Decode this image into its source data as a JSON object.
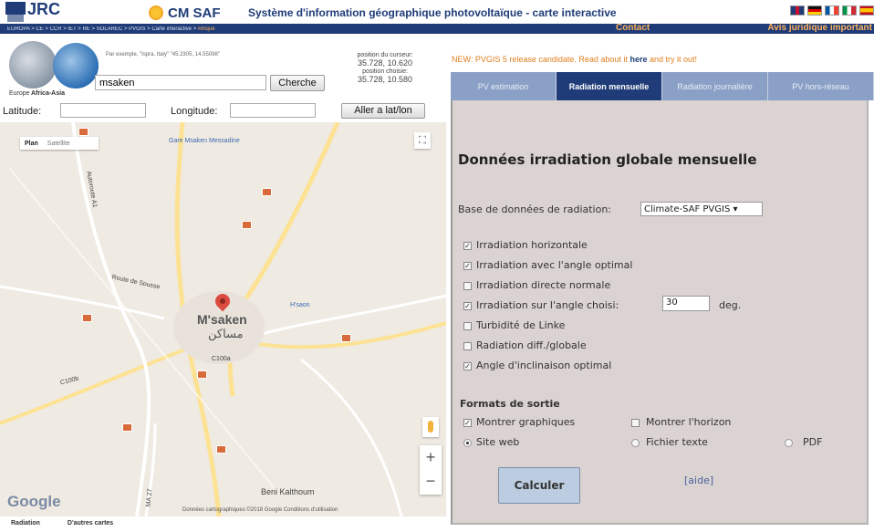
{
  "header": {
    "logo_text": "JRC",
    "cmsaf_text": "CM SAF",
    "title": "Système d'information géographique photovoltaïque - carte interactive",
    "breadcrumb": "EUROPA > CE > CCR > IET > RE > SOLAREC > PVGIS > Carte interactive > ",
    "breadcrumb_current": "Afrique",
    "contact": "Contact",
    "legal": "Avis juridique important",
    "flags": [
      {
        "name": "uk-flag",
        "colors": [
          "#1f3c78",
          "#ffffff",
          "#c8102e"
        ]
      },
      {
        "name": "de-flag",
        "colors": [
          "#111111",
          "#dd0000",
          "#ffce00"
        ]
      },
      {
        "name": "fr-flag",
        "colors": [
          "#0055a4",
          "#ffffff",
          "#ef4135"
        ]
      },
      {
        "name": "it-flag",
        "colors": [
          "#009246",
          "#ffffff",
          "#ce2b37"
        ]
      },
      {
        "name": "es-flag",
        "colors": [
          "#c60b1e",
          "#ffc400",
          "#c60b1e"
        ]
      }
    ]
  },
  "search": {
    "europe_label": "Europe",
    "africa_label": "Africa-Asia",
    "hint": "Par exemple, \"Ispra, Italy\" \"45.2305, 14.55098\"",
    "query": "msaken",
    "search_button": "Cherche",
    "cursor_label": "position du curseur:",
    "cursor_value": "35.728, 10.620",
    "chosen_label": "position choisie:",
    "chosen_value": "35.728, 10.580",
    "latitude_label": "Latitude:",
    "latitude_value": "",
    "longitude_label": "Longitude:",
    "longitude_value": "",
    "goto_button": "Aller a lat/lon"
  },
  "map": {
    "type_plan": "Plan",
    "type_satellite": "Satellite",
    "city": "M'saken",
    "city_ar": "مساكن",
    "poi_station": "Gare Msaken Messadine",
    "poi_right": "H'saon",
    "road_left": "Route de Sousse",
    "road_c100a": "C100a",
    "road_c100b": "C100b",
    "road_a1": "Autoroute A1",
    "road_ma": "MA 27",
    "village": "Beni Kalthoum",
    "credit": "Données cartographiques ©2018 Google   Conditions d'utilisation",
    "google": "Google",
    "zoom_in": "+",
    "zoom_out": "−",
    "fullscreen": "⛶"
  },
  "bottom_tabs": {
    "t1": "Radiation",
    "t2": "D'autres cartes"
  },
  "news": {
    "prefix": "NEW: PVGIS 5 release candidate. Read about it ",
    "link": "here",
    "suffix": " and try it out!"
  },
  "tabs": [
    {
      "label": "PV estimation",
      "active": false
    },
    {
      "label": "Radiation mensuelle",
      "active": true
    },
    {
      "label": "Radiation journalière",
      "active": false
    },
    {
      "label": "PV hors-réseau",
      "active": false
    }
  ],
  "panel": {
    "title": "Données irradiation globale mensuelle",
    "db_label": "Base de données de radiation:",
    "db_value": "Climate-SAF PVGIS",
    "options": [
      {
        "label": "Irradiation horizontale",
        "checked": true
      },
      {
        "label": "Irradiation avec l'angle optimal",
        "checked": true
      },
      {
        "label": "Irradiation directe normale",
        "checked": false
      },
      {
        "label": "Irradiation sur l'angle choisi:",
        "checked": true
      },
      {
        "label": "Turbidité de Linke",
        "checked": false
      },
      {
        "label": "Radiation diff./globale",
        "checked": false
      },
      {
        "label": "Angle d'inclinaison optimal",
        "checked": true
      }
    ],
    "angle_value": "30",
    "angle_unit": "deg.",
    "formats_title": "Formats de sortie",
    "show_graphs": "Montrer graphiques",
    "show_horizon": "Montrer l'horizon",
    "site_web": "Site web",
    "text_file": "Fichier texte",
    "pdf": "PDF",
    "calc_button": "Calculer",
    "help_link": "[aide]"
  }
}
